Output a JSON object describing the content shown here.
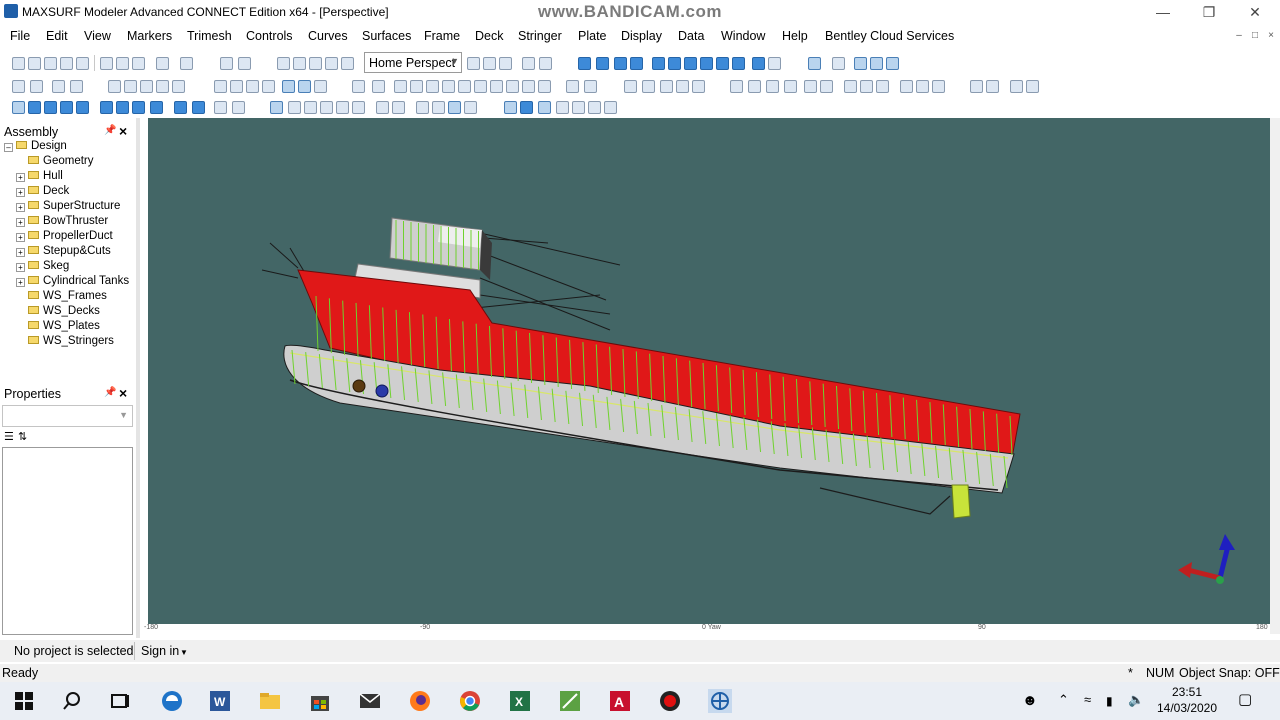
{
  "window": {
    "title": "MAXSURF Modeler Advanced CONNECT Edition x64 - [Perspective]",
    "watermark": "www.BANDICAM.com"
  },
  "menu": [
    "File",
    "Edit",
    "View",
    "Markers",
    "Trimesh",
    "Controls",
    "Curves",
    "Surfaces",
    "Frame",
    "Deck",
    "Stringer",
    "Plate",
    "Display",
    "Data",
    "Window",
    "Help",
    "Bentley Cloud Services"
  ],
  "toolbar": {
    "view_combo_value": "Home Perspect"
  },
  "assembly": {
    "title": "Assembly",
    "root": "Design",
    "items": [
      "Geometry",
      "Hull",
      "Deck",
      "SuperStructure",
      "BowThruster",
      "PropellerDuct",
      "Stepup&Cuts",
      "Skeg",
      "Cylindrical Tanks",
      "WS_Frames",
      "WS_Decks",
      "WS_Plates",
      "WS_Stringers"
    ]
  },
  "properties": {
    "title": "Properties"
  },
  "viewport": {
    "background": "#436666",
    "hull_color": "#cfcfcf",
    "deck_color": "#e01818",
    "frame_line_color": "#6fd22e",
    "ruler_labels": [
      "-180",
      "-90",
      "0 Yaw",
      "90",
      "180"
    ],
    "view_name": "Perspective"
  },
  "bottom": {
    "project_status": "No project is selected",
    "sign_in": "Sign in"
  },
  "status": {
    "left": "Ready",
    "star": "*",
    "num": "NUM",
    "snap": "Object Snap: OFF"
  },
  "taskbar": {
    "time": "23:51",
    "date": "14/03/2020"
  }
}
